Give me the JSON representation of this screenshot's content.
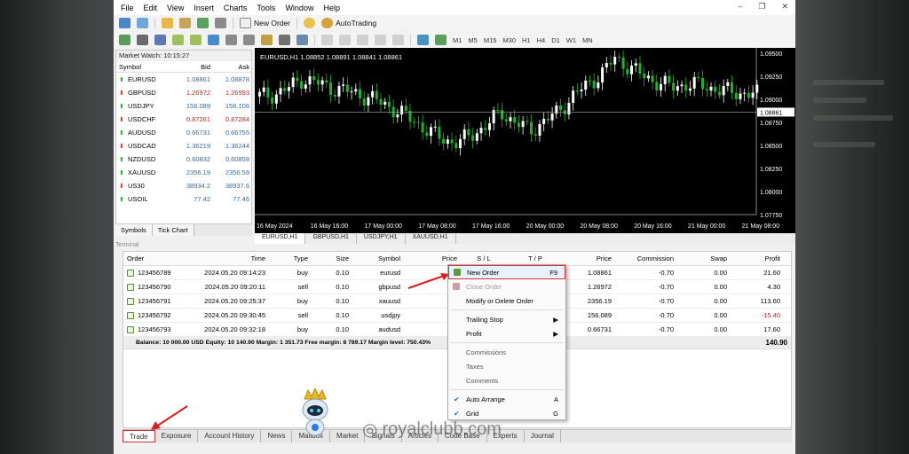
{
  "menu": {
    "items": [
      "File",
      "Edit",
      "View",
      "Insert",
      "Charts",
      "Tools",
      "Window",
      "Help"
    ]
  },
  "toolbar": {
    "new_order": "New Order",
    "autotrading": "AutoTrading",
    "timeframes": [
      "M1",
      "M5",
      "M15",
      "M30",
      "H1",
      "H4",
      "D1",
      "W1",
      "MN"
    ]
  },
  "market_watch": {
    "title": "Market Watch: 10:15:27",
    "headers": {
      "symbol": "Symbol",
      "bid": "Bid",
      "ask": "Ask"
    },
    "rows": [
      {
        "sym": "EURUSD",
        "bid": "1.08861",
        "ask": "1.08878",
        "dir": "up",
        "bidcolor": "blue"
      },
      {
        "sym": "GBPUSD",
        "bid": "1.26972",
        "ask": "1.26993",
        "dir": "down",
        "bidcolor": "red"
      },
      {
        "sym": "USDJPY",
        "bid": "156.089",
        "ask": "156.106",
        "dir": "up",
        "bidcolor": "blue"
      },
      {
        "sym": "USDCHF",
        "bid": "0.87261",
        "ask": "0.87284",
        "dir": "down",
        "bidcolor": "red"
      },
      {
        "sym": "AUDUSD",
        "bid": "0.66731",
        "ask": "0.66755",
        "dir": "up",
        "bidcolor": "blue"
      },
      {
        "sym": "USDCAD",
        "bid": "1.36219",
        "ask": "1.36244",
        "dir": "down",
        "bidcolor": "blue"
      },
      {
        "sym": "NZDUSD",
        "bid": "0.60832",
        "ask": "0.60858",
        "dir": "up",
        "bidcolor": "blue"
      },
      {
        "sym": "XAUUSD",
        "bid": "2356.19",
        "ask": "2356.59",
        "dir": "up",
        "bidcolor": "blue"
      },
      {
        "sym": "US30",
        "bid": "38934.2",
        "ask": "38937.6",
        "dir": "down",
        "bidcolor": "blue"
      },
      {
        "sym": "USOIL",
        "bid": "77.42",
        "ask": "77.46",
        "dir": "up",
        "bidcolor": "blue"
      }
    ],
    "tabs": [
      "Symbols",
      "Tick Chart"
    ]
  },
  "chart": {
    "title": "EURUSD,H1  1.08852 1.08891 1.08841 1.08861",
    "yticks": [
      "1.09500",
      "1.09250",
      "1.09000",
      "1.08750",
      "1.08500",
      "1.08250",
      "1.08000",
      "1.07750"
    ],
    "current": "1.08861",
    "xticks": [
      "16 May 2024",
      "16 May 16:00",
      "17 May 00:00",
      "17 May 08:00",
      "17 May 16:00",
      "20 May 00:00",
      "20 May 08:00",
      "20 May 16:00",
      "21 May 00:00",
      "21 May 08:00"
    ],
    "tabs": [
      "EURUSD,H1",
      "GBPUSD,H1",
      "USDJPY,H1",
      "XAUUSD,H1"
    ],
    "bullish_color": "#ffffff",
    "bearish_color": "#1db32a"
  },
  "terminal": {
    "label": "Terminal",
    "headers": {
      "order": "Order",
      "time": "Time",
      "type": "Type",
      "size": "Size",
      "symbol": "Symbol",
      "price": "Price",
      "sl": "S / L",
      "tp": "T / P",
      "price2": "Price",
      "commission": "Commission",
      "swap": "Swap",
      "profit": "Profit"
    },
    "rows": [
      {
        "order": "123456789",
        "time": "2024.05.20 09:14:23",
        "type": "buy",
        "size": "0.10",
        "symbol": "eurusd",
        "price": "1.0",
        "price2": "1.08861",
        "commission": "-0.70",
        "swap": "0.00",
        "profit": "21.60"
      },
      {
        "order": "123456790",
        "time": "2024.05.20 09:20:11",
        "type": "sell",
        "size": "0.10",
        "symbol": "gbpusd",
        "price": "1.2",
        "price2": "1.26972",
        "commission": "-0.70",
        "swap": "0.00",
        "profit": "4.30"
      },
      {
        "order": "123456791",
        "time": "2024.05.20 09:25:37",
        "type": "buy",
        "size": "0.10",
        "symbol": "xauusd",
        "price": "23",
        "price2": "2356.19",
        "commission": "-0.70",
        "swap": "0.00",
        "profit": "113.60"
      },
      {
        "order": "123456792",
        "time": "2024.05.20 09:30:45",
        "type": "sell",
        "size": "0.10",
        "symbol": "usdjpy",
        "price": "15",
        "price2": "156.089",
        "commission": "-0.70",
        "swap": "0.00",
        "profit": "-15.40"
      },
      {
        "order": "123456793",
        "time": "2024.05.20 09:32:18",
        "type": "buy",
        "size": "0.10",
        "symbol": "audusd",
        "price": "0.6",
        "price2": "0.66731",
        "commission": "-0.70",
        "swap": "0.00",
        "profit": "17.60"
      }
    ],
    "balance": "Balance: 10 000.00 USD  Equity: 10 140.90  Margin: 1 351.73  Free margin: 8 789.17  Margin level: 750.43%",
    "total": "140.90",
    "tabs": [
      "Trade",
      "Exposure",
      "Account History",
      "News",
      "Mailbox",
      "Market",
      "Signals",
      "Articles",
      "Code Base",
      "Experts",
      "Journal"
    ]
  },
  "context_menu": {
    "new_order": "New Order",
    "new_order_key": "F9",
    "close_order": "Close Order",
    "modify": "Modify or Delete Order",
    "trailing": "Trailing Stop",
    "profit": "Profit",
    "commissions": "Commissions",
    "taxes": "Taxes",
    "comments": "Comments",
    "auto_arrange": "Auto Arrange",
    "auto_arrange_key": "A",
    "grid": "Grid",
    "grid_key": "G"
  },
  "watermark": "royalclubb.com"
}
